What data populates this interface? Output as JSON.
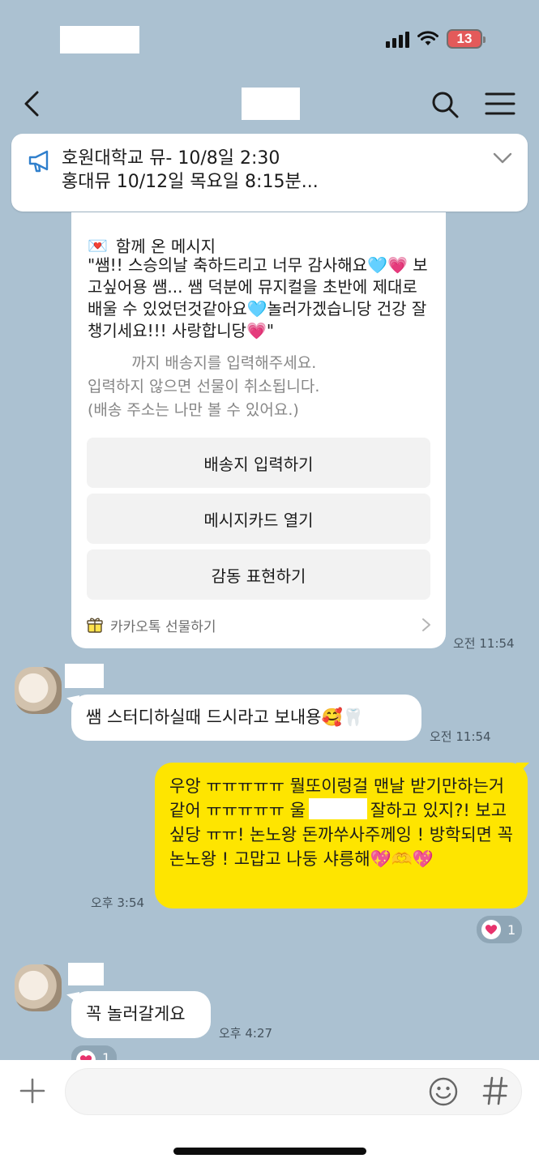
{
  "status_bar": {
    "battery": "13"
  },
  "notice": {
    "text": "호원대학교 뮤- 10/8일 2:30\n홍대뮤 10/12일 목요일 8:15분..."
  },
  "gift_card": {
    "header_emoji": "💌",
    "header_label": "함께 온 메시지",
    "message": "\"쌤!! 스승의날 축하드리고 너무 감사해요🩵💗 보고싶어용 쌤... 쌤 덕분에 뮤지컬을 초반에 제대로 배울 수 있었던것같아요🩵놀러가겠습니당 건강 잘 챙기세요!!! 사랑합니당💗\"",
    "guide": "         까지 배송지를 입력해주세요.\n입력하지 않으면 선물이 취소됩니다.\n(배송 주소는 나만 볼 수 있어요.)",
    "buttons": [
      "배송지 입력하기",
      "메시지카드 열기",
      "감동 표현하기"
    ],
    "footer_label": "카카오톡 선물하기",
    "time": "오전 11:54"
  },
  "messages": [
    {
      "text": "쌤 스터디하실때 드시라고 보내용🥰🦷",
      "time": "오전 11:54"
    },
    {
      "text_part1": "우앙 ㅠㅠㅠㅠㅠ 뭘또이렁걸 맨날 받기만하는거같어 ㅠㅠㅠㅠㅠ 울",
      "text_part2": "잘하고 있지?! 보고싶당 ㅠㅠ! 논노왕 돈까쑤사주께잉 ! 방학되면 꼭 논노왕 ! 고맙고 나둥 샤릉해💖🫶💖",
      "time": "오후 3:54",
      "reaction_count": "1"
    },
    {
      "text": "꼭 놀러갈게요",
      "time": "오후 4:27",
      "reaction_count": "1"
    }
  ],
  "input": {
    "placeholder": ""
  },
  "icons": {
    "back": "back-arrow-icon",
    "search": "search-icon",
    "menu": "hamburger-menu-icon",
    "notice": "megaphone-icon",
    "gift": "gift-box-icon",
    "emoji": "emoji-icon",
    "hash": "hash-icon",
    "plus": "plus-icon"
  },
  "colors": {
    "background": "#abc1d1",
    "outgoing_bubble": "#fee500",
    "reaction_heart": "#e8336d"
  }
}
